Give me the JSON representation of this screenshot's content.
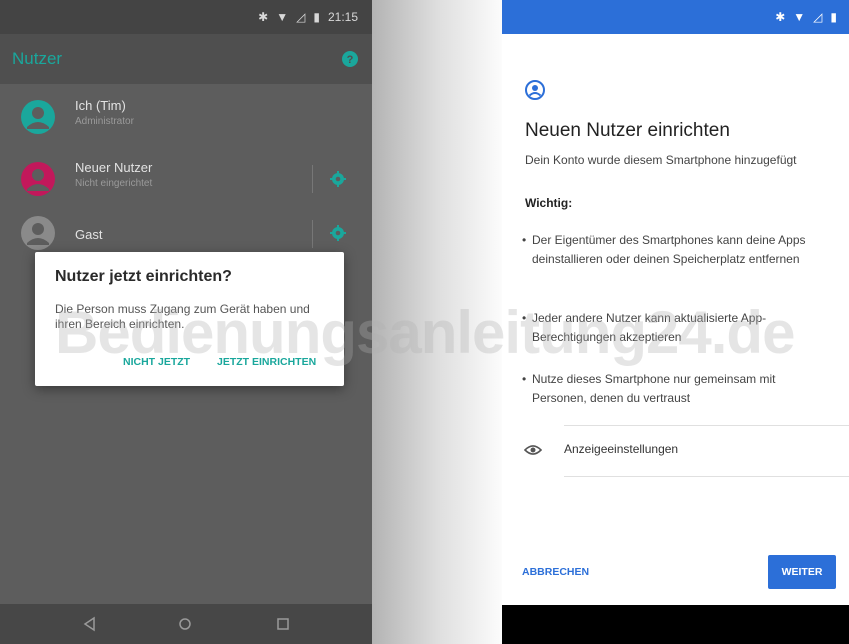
{
  "left": {
    "status_time": "21:15",
    "title": "Nutzer",
    "users": [
      {
        "name": "Ich (Tim)",
        "sub": "Administrator",
        "color": "#1aa79c"
      },
      {
        "name": "Neuer Nutzer",
        "sub": "Nicht eingerichtet",
        "color": "#c2185b"
      },
      {
        "name": "Gast",
        "sub": "",
        "color": "#8a8a8a"
      }
    ],
    "dialog": {
      "title": "Nutzer jetzt einrichten?",
      "message": "Die Person muss Zugang zum Gerät haben und ihren Bereich einrichten.",
      "btn_later": "NICHT JETZT",
      "btn_setup": "JETZT EINRICHTEN"
    },
    "accent": "#1aa79c"
  },
  "right": {
    "accent": "#2c6fd8",
    "title": "Neuen Nutzer einrichten",
    "subtitle": "Dein Konto wurde diesem Smartphone hinzugefügt",
    "important": "Wichtig:",
    "bullets": [
      "Der Eigentümer des Smartphones kann deine Apps deinstallieren oder deinen Speicherplatz entfernen",
      "Jeder andere Nutzer kann aktualisierte App-Berechtigungen akzeptieren",
      "Nutze dieses Smartphone nur gemeinsam mit Personen, denen du vertraust"
    ],
    "display_settings": "Anzeigeeinstellungen",
    "cancel": "ABBRECHEN",
    "next": "WEITER"
  },
  "watermark": "Bedienungsanleitung24.de"
}
